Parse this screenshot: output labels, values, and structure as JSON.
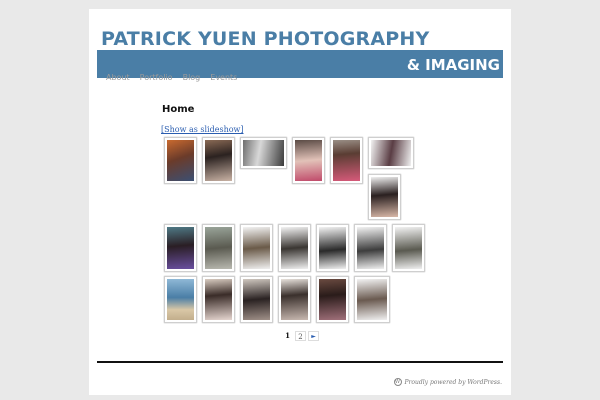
{
  "header": {
    "title_line1": "PATRICK YUEN PHOTOGRAPHY",
    "title_line2": "& IMAGING",
    "brand_color": "#4a7ea6"
  },
  "menu": {
    "items": [
      {
        "label": "About"
      },
      {
        "label": "Portfolio"
      },
      {
        "label": "Blog"
      },
      {
        "label": "Events"
      }
    ]
  },
  "content": {
    "page_title": "Home",
    "slideshow_link": "[Show as slideshow]"
  },
  "gallery": {
    "thumbnail_count": 21,
    "thumbnail_icon": "photo-thumbnail"
  },
  "pagination": {
    "current": "1",
    "page2": "2",
    "next": "►"
  },
  "footer": {
    "icon": "wordpress-icon",
    "text": "Proudly powered by WordPress."
  }
}
